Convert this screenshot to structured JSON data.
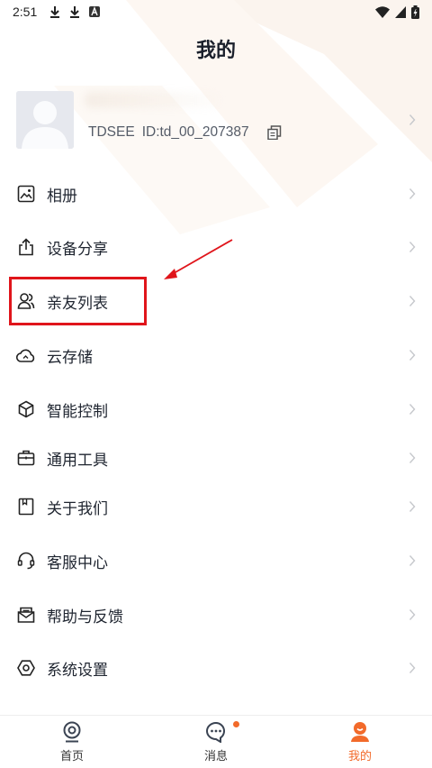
{
  "status_bar": {
    "time": "2:51"
  },
  "header": {
    "title": "我的"
  },
  "profile": {
    "app_name": "TDSEE",
    "user_id": "ID:td_00_207387"
  },
  "menu": {
    "items": [
      {
        "label": "相册",
        "icon": "album-icon"
      },
      {
        "label": "设备分享",
        "icon": "share-icon"
      },
      {
        "label": "亲友列表",
        "icon": "contacts-icon"
      },
      {
        "label": "云存储",
        "icon": "cloud-icon"
      },
      {
        "label": "智能控制",
        "icon": "smart-cube-icon"
      },
      {
        "label": "通用工具",
        "icon": "toolbox-icon"
      },
      {
        "label": "关于我们",
        "icon": "bookmark-icon"
      },
      {
        "label": "客服中心",
        "icon": "headset-icon"
      },
      {
        "label": "帮助与反馈",
        "icon": "feedback-mail-icon"
      },
      {
        "label": "系统设置",
        "icon": "settings-hex-icon"
      }
    ]
  },
  "tabbar": {
    "tabs": [
      {
        "label": "首页",
        "icon": "camera-icon",
        "active": false
      },
      {
        "label": "消息",
        "icon": "message-icon",
        "active": false,
        "has_badge": true
      },
      {
        "label": "我的",
        "icon": "profile-face-icon",
        "active": true
      }
    ]
  },
  "colors": {
    "accent": "#f26a2a",
    "highlight_box": "#e0151b",
    "arrow": "#e0151b"
  }
}
